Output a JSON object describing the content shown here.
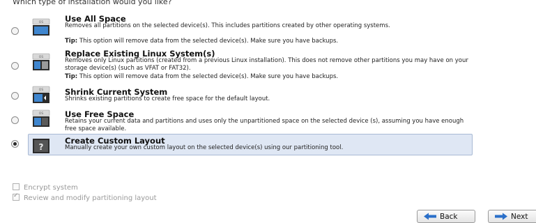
{
  "question": "Which type of installation would you like?",
  "options": [
    {
      "title": "Use All Space",
      "description": "Removes all partitions on the selected device(s).  This includes partitions created by other operating systems.",
      "tip_label": "Tip:",
      "tip_text": " This option will remove data from the selected device(s).  Make sure you have backups.",
      "selected": false
    },
    {
      "title": "Replace Existing Linux System(s)",
      "description": "Removes only Linux partitions (created from a previous Linux installation).  This does not remove other partitions you may have on your storage device(s) (such as VFAT or FAT32).",
      "tip_label": "Tip:",
      "tip_text": " This option will remove data from the selected device(s).  Make sure you have backups.",
      "selected": false
    },
    {
      "title": "Shrink Current System",
      "description": "Shrinks existing partitions to create free space for the default layout.",
      "selected": false
    },
    {
      "title": "Use Free Space",
      "description": "Retains your current data and partitions and uses only the unpartitioned space on the selected device (s), assuming you have enough free space available.",
      "selected": false
    },
    {
      "title": "Create Custom Layout",
      "description": "Manually create your own custom layout on the selected device(s) using our partitioning tool.",
      "selected": true
    }
  ],
  "encrypt_system": {
    "label": "Encrypt system",
    "checked": false
  },
  "review_layout": {
    "label": "Review and modify partitioning layout",
    "checked": true
  },
  "buttons": {
    "back": "Back",
    "next": "Next"
  },
  "colors": {
    "selection_bg": "#dfe7f4",
    "arrow": "#2a6fc9",
    "disk_top": "#d8d8d8",
    "disk_body": "#2b2b2b"
  },
  "icons": [
    "disk-use-all-icon",
    "disk-replace-linux-icon",
    "disk-shrink-icon",
    "disk-free-space-icon",
    "disk-custom-question-icon"
  ]
}
